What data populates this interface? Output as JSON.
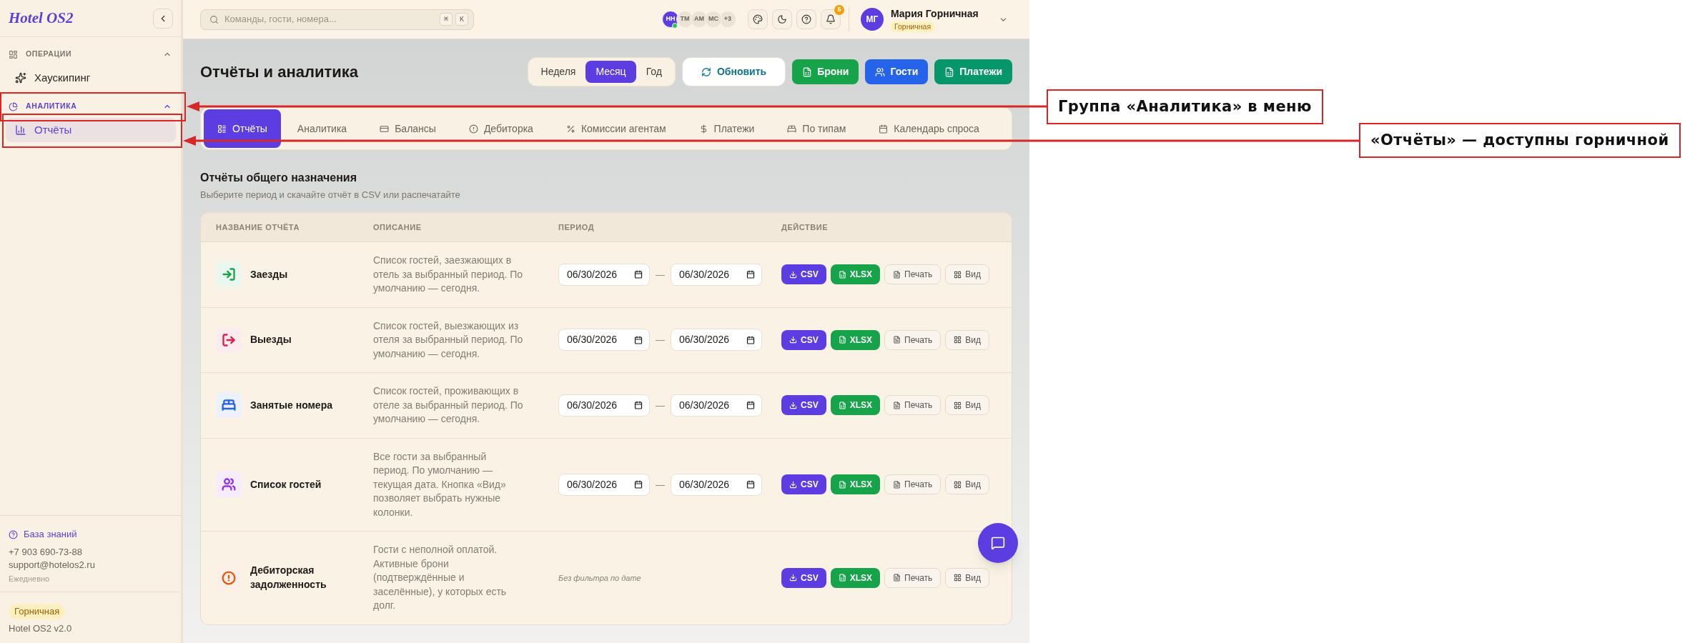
{
  "sidebar": {
    "logo": "Hotel OS2",
    "sections": [
      {
        "title": "ОПЕРАЦИИ",
        "selected": false,
        "expanded": true,
        "items": [
          {
            "label": "Хаускипинг",
            "selected": false
          }
        ]
      },
      {
        "title": "АНАЛИТИКА",
        "selected": true,
        "expanded": true,
        "items": [
          {
            "label": "Отчёты",
            "selected": true
          }
        ]
      }
    ],
    "help_link": "База знаний",
    "phone": "+7 903 690-73-88",
    "email": "support@hotelos2.ru",
    "hours": "Ежедневно",
    "role_badge": "Горничная",
    "version": "Hotel OS2 v2.0"
  },
  "topbar": {
    "search": {
      "placeholder": "Команды, гости, номера...",
      "shortcut": [
        "⌘",
        "K"
      ]
    },
    "online_users": [
      {
        "initials": "НН",
        "online": true
      },
      {
        "initials": "ТМ",
        "online": false
      },
      {
        "initials": "АМ",
        "online": false
      },
      {
        "initials": "МС",
        "online": false
      }
    ],
    "more_users": "+3",
    "notifications": "5",
    "user": {
      "initials": "МГ",
      "name": "Мария Горничная",
      "role": "Горничная"
    }
  },
  "page": {
    "title": "Отчёты и аналитика",
    "periods": [
      {
        "label": "Неделя",
        "selected": false
      },
      {
        "label": "Месяц",
        "selected": true
      },
      {
        "label": "Год",
        "selected": false
      }
    ],
    "actions": [
      {
        "label": "Обновить",
        "kind": "refresh"
      },
      {
        "label": "Брони",
        "kind": "bookings",
        "color": "#16a34a"
      },
      {
        "label": "Гости",
        "kind": "guests",
        "color": "#2563eb"
      },
      {
        "label": "Платежи",
        "kind": "payments",
        "color": "#059669"
      }
    ],
    "tabs": [
      {
        "label": "Отчёты",
        "selected": true
      },
      {
        "label": "Аналитика",
        "selected": false
      },
      {
        "label": "Балансы",
        "selected": false
      },
      {
        "label": "Дебиторка",
        "selected": false
      },
      {
        "label": "Комиссии агентам",
        "selected": false
      },
      {
        "label": "Платежи",
        "selected": false
      },
      {
        "label": "По типам",
        "selected": false
      },
      {
        "label": "Календарь спроса",
        "selected": false
      }
    ]
  },
  "reports": {
    "title": "Отчёты общего назначения",
    "subtitle": "Выберите период и скачайте отчёт в CSV или распечатайте",
    "columns": [
      "НАЗВАНИЕ ОТЧЁТА",
      "ОПИСАНИЕ",
      "ПЕРИОД",
      "ДЕЙСТВИЕ"
    ],
    "rows": [
      {
        "name": "Заезды",
        "color": "#16a34a",
        "description": "Список гостей, заезжающих в отель за выбранный период. По умолчанию — сегодня.",
        "period": {
          "kind": "range",
          "from": "06/30/2026",
          "separator": "—",
          "to": "06/30/2026"
        },
        "actions": [
          {
            "label": "CSV",
            "kind": "csv"
          },
          {
            "label": "XLSX",
            "kind": "xlsx"
          },
          {
            "label": "Печать",
            "kind": "print"
          },
          {
            "label": "Вид",
            "kind": "view"
          }
        ]
      },
      {
        "name": "Выезды",
        "color": "#e11d48",
        "description": "Список гостей, выезжающих из отеля за выбранный период. По умолчанию — сегодня.",
        "period": {
          "kind": "range",
          "from": "06/30/2026",
          "separator": "—",
          "to": "06/30/2026"
        },
        "actions": [
          {
            "label": "CSV",
            "kind": "csv"
          },
          {
            "label": "XLSX",
            "kind": "xlsx"
          },
          {
            "label": "Печать",
            "kind": "print"
          },
          {
            "label": "Вид",
            "kind": "view"
          }
        ]
      },
      {
        "name": "Занятые номера",
        "color": "#2563eb",
        "description": "Список гостей, проживающих в отеле за выбранный период. По умолчанию — сегодня.",
        "period": {
          "kind": "range",
          "from": "06/30/2026",
          "separator": "—",
          "to": "06/30/2026"
        },
        "actions": [
          {
            "label": "CSV",
            "kind": "csv"
          },
          {
            "label": "XLSX",
            "kind": "xlsx"
          },
          {
            "label": "Печать",
            "kind": "print"
          },
          {
            "label": "Вид",
            "kind": "view"
          }
        ]
      },
      {
        "name": "Список гостей",
        "color": "#9333ea",
        "description": "Все гости за выбранный период. По умолчанию — текущая дата. Кнопка «Вид» позволяет выбрать нужные колонки.",
        "period": {
          "kind": "range",
          "from": "06/30/2026",
          "separator": "—",
          "to": "06/30/2026"
        },
        "actions": [
          {
            "label": "CSV",
            "kind": "csv"
          },
          {
            "label": "XLSX",
            "kind": "xlsx"
          },
          {
            "label": "Печать",
            "kind": "print"
          },
          {
            "label": "Вид",
            "kind": "view"
          }
        ]
      },
      {
        "name": "Дебиторская задолженность",
        "color": "#ea580c",
        "description": "Гости с неполной оплатой. Активные брони (подтверждённые и заселённые), у которых есть долг.",
        "period": {
          "kind": "none",
          "note": "Без фильтра по дате"
        },
        "actions": [
          {
            "label": "CSV",
            "kind": "csv"
          },
          {
            "label": "XLSX",
            "kind": "xlsx"
          },
          {
            "label": "Печать",
            "kind": "print"
          },
          {
            "label": "Вид",
            "kind": "view"
          }
        ]
      }
    ]
  },
  "annotations": [
    {
      "text": "Группа «Аналитика» в меню"
    },
    {
      "text": "«Отчёты» — доступны горничной"
    }
  ]
}
